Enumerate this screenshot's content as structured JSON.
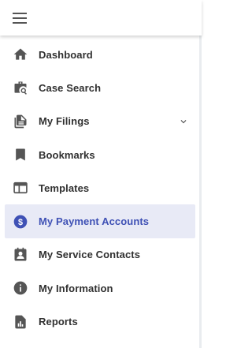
{
  "header": {
    "menu_icon": "hamburger-menu-icon"
  },
  "colors": {
    "icon": "#555555",
    "label": "#303030",
    "active_bg": "#e8eaf6",
    "active_fg": "#3f51b5"
  },
  "nav": {
    "items": [
      {
        "label": "Dashboard",
        "icon": "home-icon"
      },
      {
        "label": "Case Search",
        "icon": "case-search-icon"
      },
      {
        "label": "My Filings",
        "icon": "filings-icon",
        "expandable": true
      },
      {
        "label": "Bookmarks",
        "icon": "bookmark-icon"
      },
      {
        "label": "Templates",
        "icon": "templates-icon"
      },
      {
        "label": "My Payment Accounts",
        "icon": "payment-icon",
        "active": true
      },
      {
        "label": "My Service Contacts",
        "icon": "contacts-icon"
      },
      {
        "label": "My Information",
        "icon": "info-icon"
      },
      {
        "label": "Reports",
        "icon": "reports-icon"
      }
    ]
  }
}
